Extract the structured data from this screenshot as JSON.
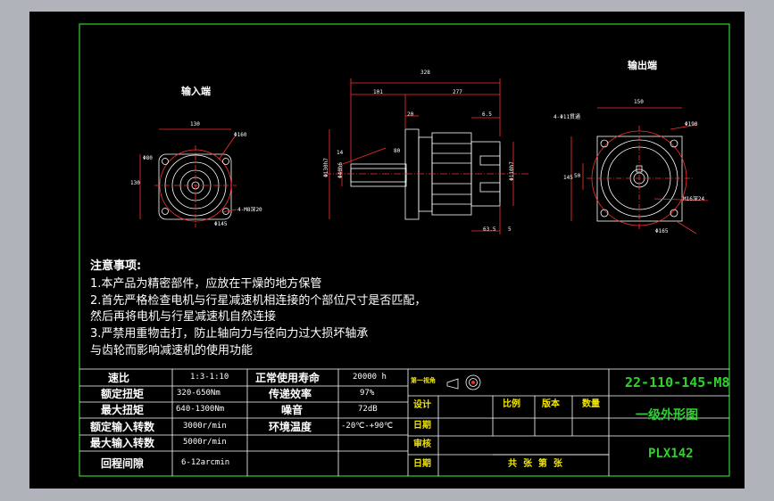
{
  "views": {
    "input_end_title": "输入端",
    "output_end_title": "输出端"
  },
  "dimensions": {
    "input": {
      "width": "130",
      "height": "130",
      "bolt_circle": "Φ160",
      "pilot": "Φ80",
      "hole_label": "4-M8深20",
      "spigot": "Φ145"
    },
    "side": {
      "overall": "328",
      "left_part": "101",
      "right_part": "277",
      "flange_t": "20",
      "step": "80",
      "shaft_len": "6.5",
      "bottom_a": "63.5",
      "bottom_b": "5",
      "dia_left": "Φ130h7",
      "dia_left2": "Φ40h6",
      "dia_right": "Φ110h7",
      "dia_key": "14"
    },
    "output": {
      "width": "150",
      "height": "145",
      "holes": "4-Φ11贯通",
      "bolt_circle": "Φ190",
      "pilot": "Φ165",
      "shaft_key": "M16深24",
      "shaft_dia": "50"
    }
  },
  "notes": [
    "注意事项:",
    "1.本产品为精密部件，应放在干燥的地方保管",
    "2.首先严格检查电机与行星减速机相连接的个部位尺寸是否匹配，",
    "然后再将电机与行星减速机自然连接",
    "3.严禁用重物击打，防止轴向力与径向力过大损坏轴承",
    "与齿轮而影响减速机的使用功能"
  ],
  "specs": {
    "left": [
      {
        "label": "速比",
        "value": "1:3-1:10"
      },
      {
        "label": "额定扭矩",
        "value": "320-650Nm"
      },
      {
        "label": "最大扭矩",
        "value": "640-1300Nm"
      },
      {
        "label": "额定输入转数",
        "value": "3000r/min"
      },
      {
        "label": "最大输入转数",
        "value": "5000r/min"
      },
      {
        "label": "回程间隙",
        "value": "6-12arcmin"
      }
    ],
    "right": [
      {
        "label": "正常使用寿命",
        "value": "20000 h"
      },
      {
        "label": "传递效率",
        "value": "97%"
      },
      {
        "label": "噪音",
        "value": "72dB"
      },
      {
        "label": "环境温度",
        "value": "-20℃-+90℃"
      }
    ]
  },
  "title_block": {
    "projection": "第一视角",
    "rows": [
      "设计",
      "日期",
      "审核",
      "日期"
    ],
    "headers": [
      "比例",
      "版本",
      "数量"
    ],
    "sheet_info": "共  张  第  张",
    "drawing_no": "22-110-145-M8",
    "drawing_title": "一级外形图",
    "model": "PLX142"
  },
  "colors": {
    "frame": "#2fd12f",
    "lines": "#ffffff",
    "dims": "#ff4040",
    "title": "#f2e600"
  }
}
